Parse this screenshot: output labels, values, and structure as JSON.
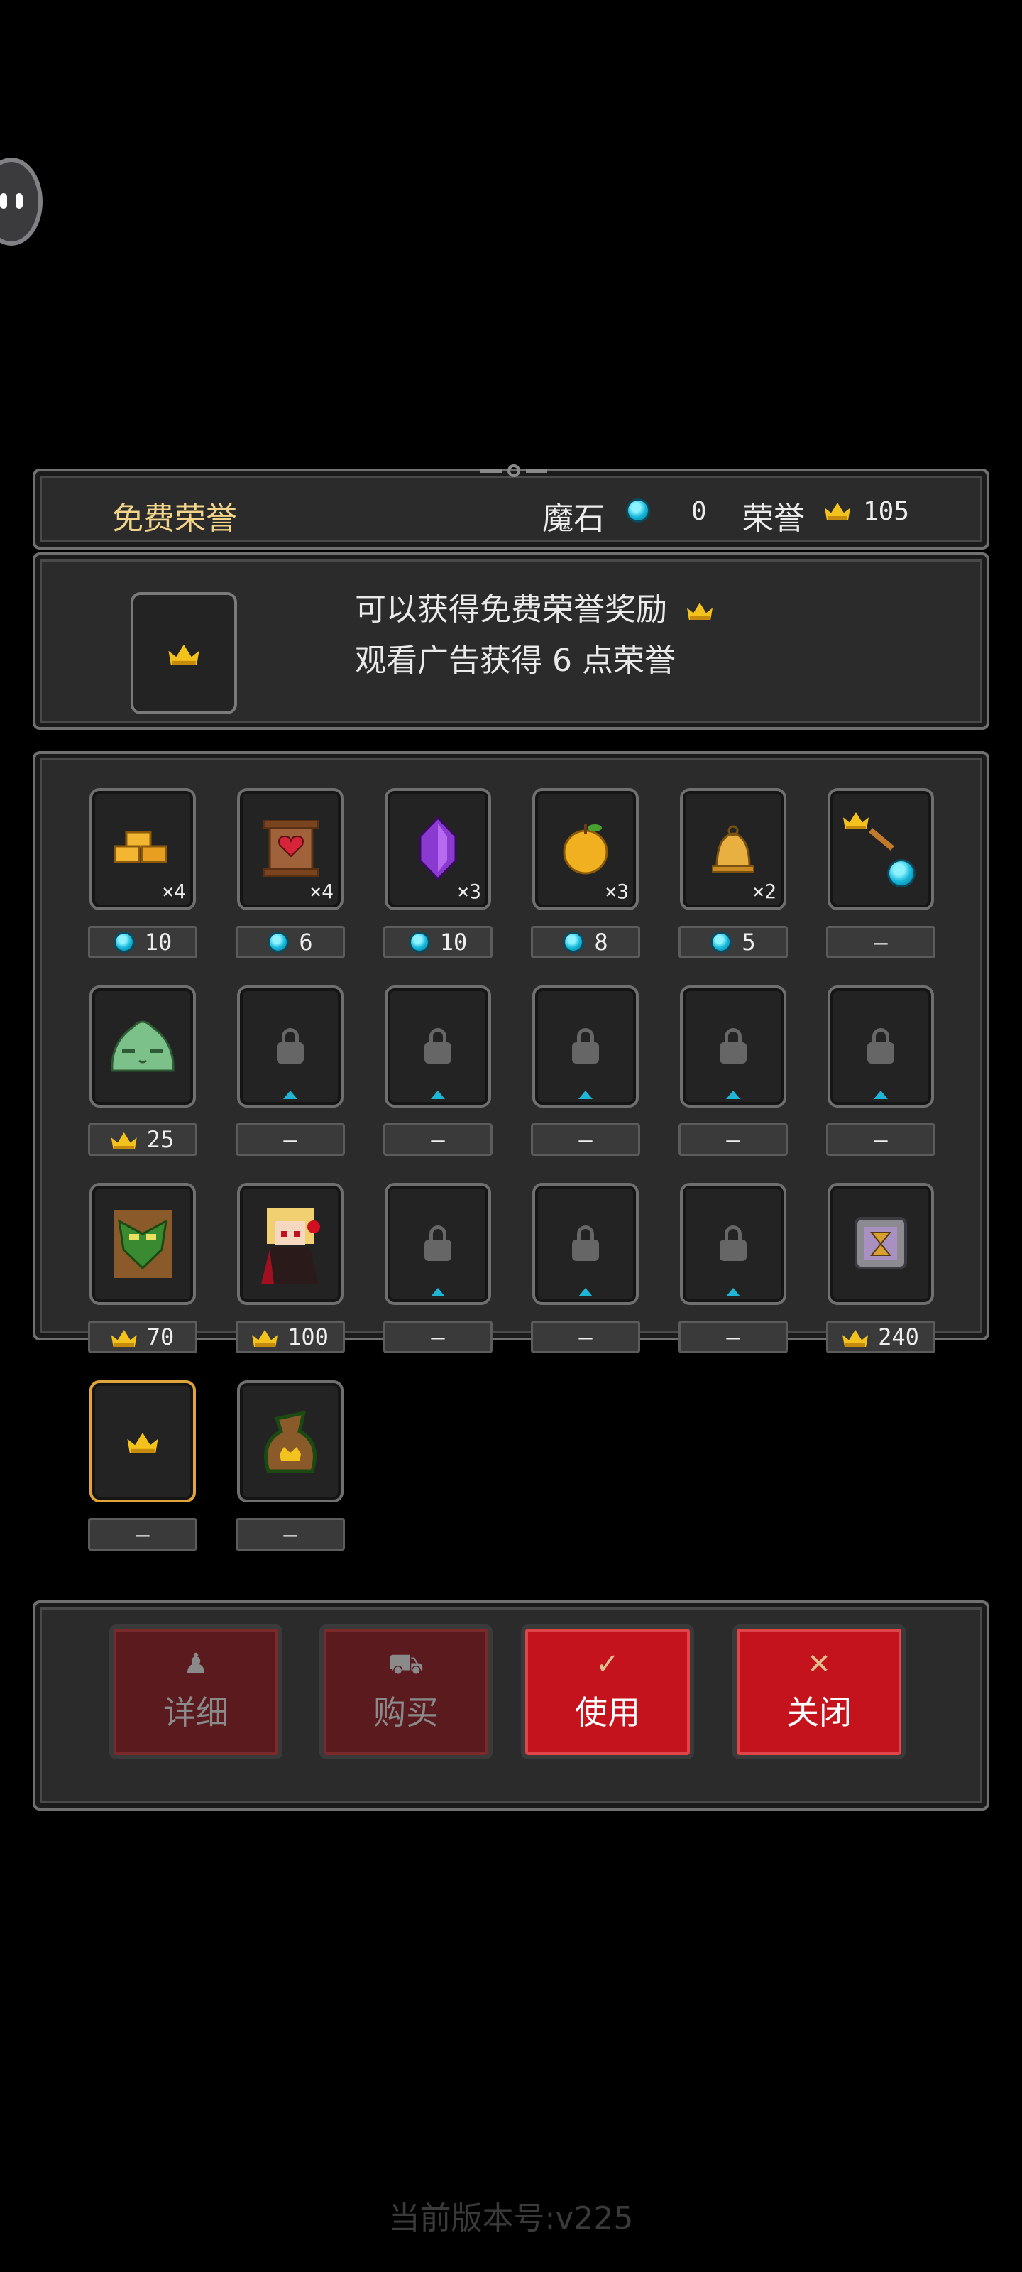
{
  "header": {
    "title": "免费荣誉",
    "magic_stone_label": "魔石",
    "magic_stone_value": "0",
    "honor_label": "荣誉",
    "honor_value": "105"
  },
  "reward": {
    "line1": "可以获得免费荣誉奖励",
    "line2": "观看广告获得 6 点荣誉"
  },
  "grid": {
    "row1": [
      {
        "name": "gold-bars",
        "qty": "×4",
        "price": "10",
        "currency": "gem"
      },
      {
        "name": "heart-scroll",
        "qty": "×4",
        "price": "6",
        "currency": "gem"
      },
      {
        "name": "purple-crystal",
        "qty": "×3",
        "price": "10",
        "currency": "gem"
      },
      {
        "name": "golden-apple",
        "qty": "×3",
        "price": "8",
        "currency": "gem"
      },
      {
        "name": "golden-bell",
        "qty": "×2",
        "price": "5",
        "currency": "gem"
      },
      {
        "name": "crown-to-gem-exchange",
        "qty": "",
        "price": "—",
        "currency": "none"
      }
    ],
    "row2": [
      {
        "name": "green-slime",
        "price": "25",
        "currency": "crown"
      },
      {
        "name": "locked",
        "price": "–"
      },
      {
        "name": "locked",
        "price": "–"
      },
      {
        "name": "locked",
        "price": "–"
      },
      {
        "name": "locked",
        "price": "–"
      },
      {
        "name": "locked",
        "price": "–"
      }
    ],
    "row3": [
      {
        "name": "tree-guardian",
        "price": "70",
        "currency": "crown"
      },
      {
        "name": "vampire-girl",
        "price": "100",
        "currency": "crown"
      },
      {
        "name": "locked",
        "price": "–"
      },
      {
        "name": "locked",
        "price": "–"
      },
      {
        "name": "locked",
        "price": "–"
      },
      {
        "name": "hourglass-frame",
        "price": "240",
        "currency": "crown"
      }
    ],
    "row4": [
      {
        "name": "free-honor",
        "price": "–"
      },
      {
        "name": "honor-bag",
        "price": "–"
      }
    ]
  },
  "buttons": {
    "detail": "详细",
    "buy": "购买",
    "use": "使用",
    "close": "关闭"
  },
  "version": "当前版本号:v225",
  "colors": {
    "accent_gold": "#f4c21c",
    "gem_cyan": "#16b8dc",
    "button_red": "#c4131c",
    "title_gold": "#f2d48a"
  }
}
